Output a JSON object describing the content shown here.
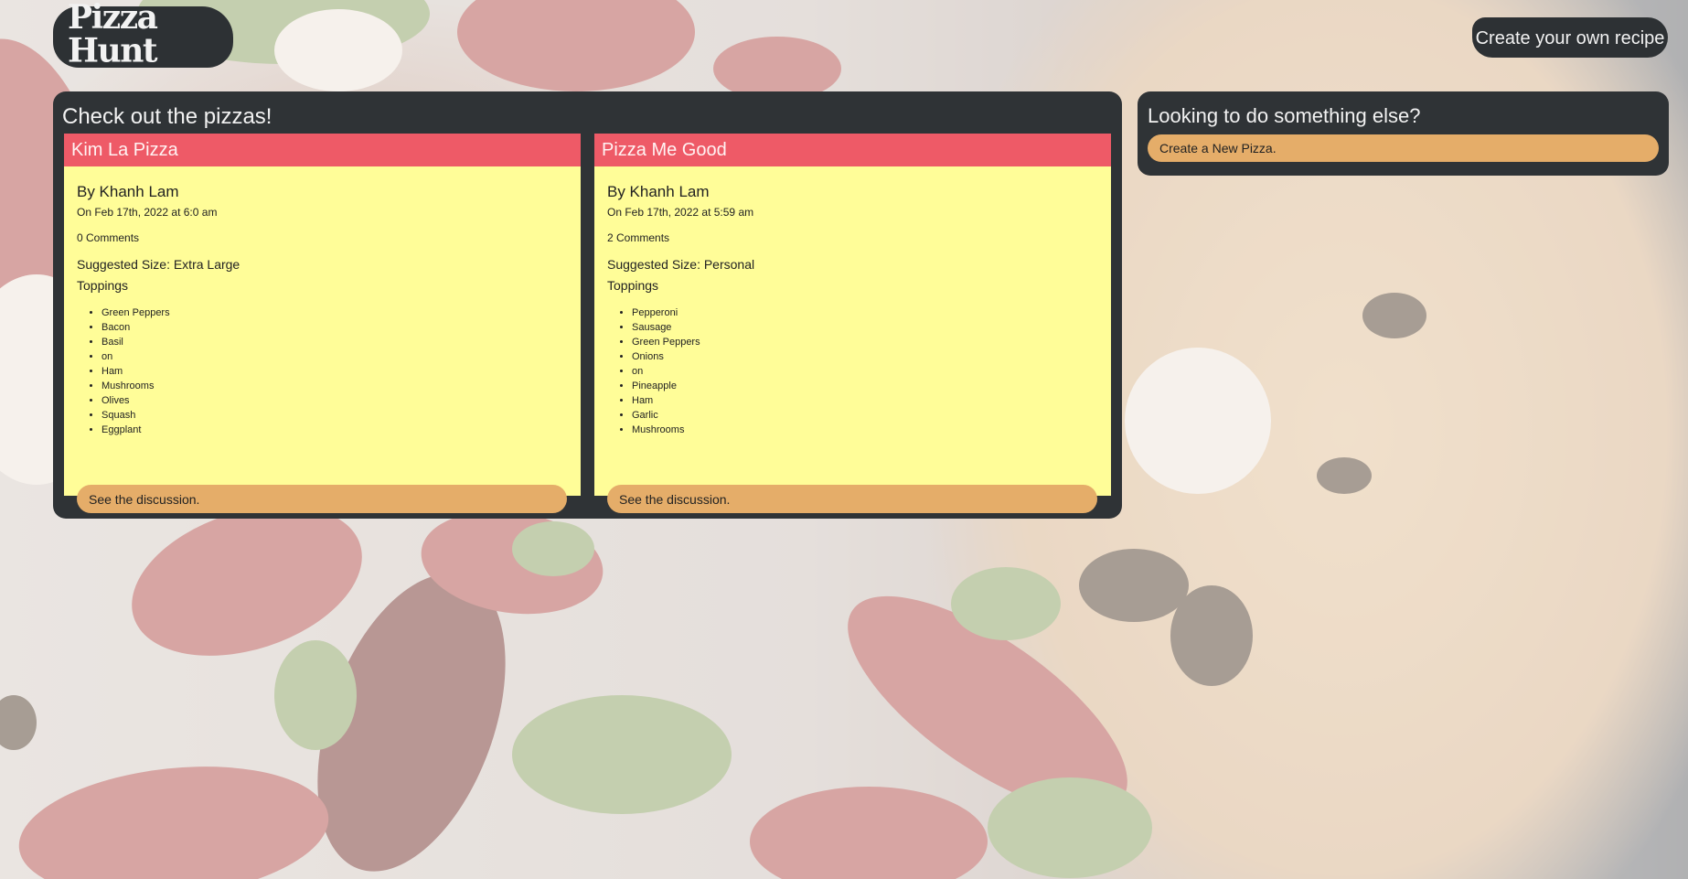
{
  "header": {
    "logo_text": "Pizza Hunt",
    "create_recipe_label": "Create your own recipe"
  },
  "main": {
    "title": "Check out the pizzas!",
    "pizzas": [
      {
        "name": "Kim La Pizza",
        "author": "By Khanh Lam",
        "date": "On Feb 17th, 2022 at 6:0 am",
        "comments": "0 Comments",
        "size": "Suggested Size: Extra Large",
        "toppings_label": "Toppings",
        "toppings": [
          "Green Peppers",
          "Bacon",
          "Basil",
          "on",
          "Ham",
          "Mushrooms",
          "Olives",
          "Squash",
          "Eggplant"
        ],
        "discussion_label": "See the discussion."
      },
      {
        "name": "Pizza Me Good",
        "author": "By Khanh Lam",
        "date": "On Feb 17th, 2022 at 5:59 am",
        "comments": "2 Comments",
        "size": "Suggested Size: Personal",
        "toppings_label": "Toppings",
        "toppings": [
          "Pepperoni",
          "Sausage",
          "Green Peppers",
          "Onions",
          "on",
          "Pineapple",
          "Ham",
          "Garlic",
          "Mushrooms"
        ],
        "discussion_label": "See the discussion."
      }
    ]
  },
  "side": {
    "title": "Looking to do something else?",
    "new_pizza_label": "Create a New Pizza."
  },
  "colors": {
    "panel": "#2f3336",
    "card_header": "#ee5a67",
    "card_body": "#fffd98",
    "button": "#e5ad69"
  }
}
